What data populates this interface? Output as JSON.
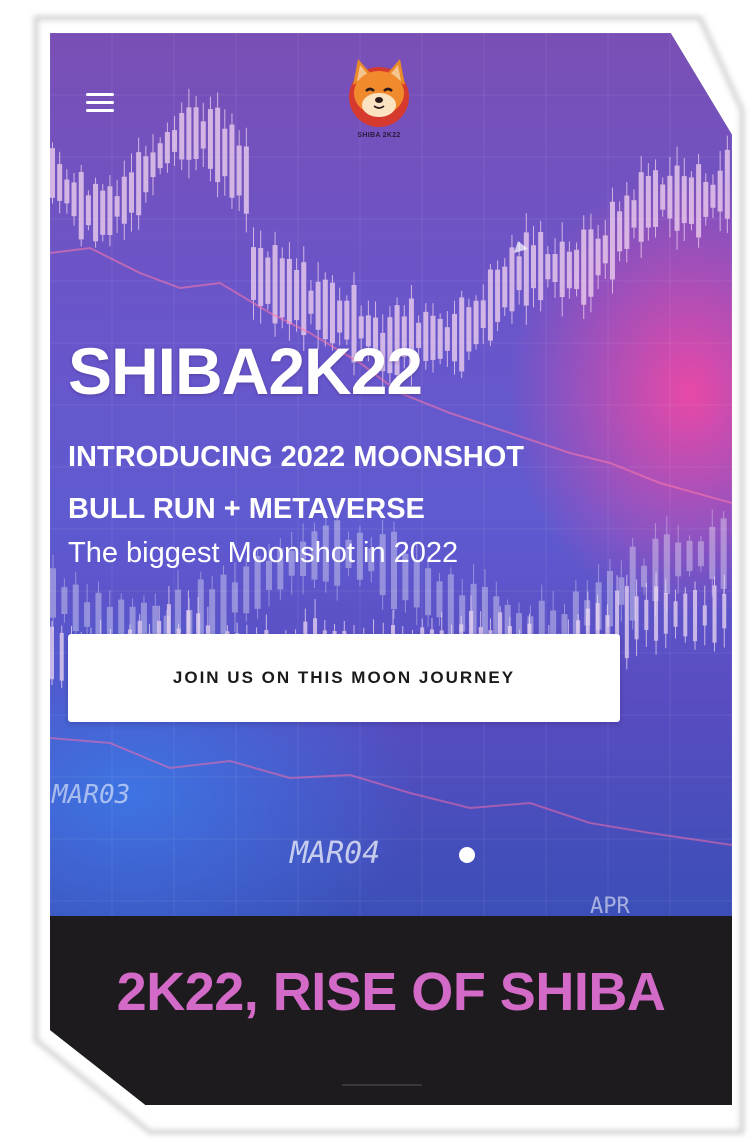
{
  "header": {
    "menu_icon": "hamburger-menu-icon",
    "logo_icon": "shiba-dog-face-icon",
    "logo_text": "SHIBA 2K22"
  },
  "hero": {
    "title": "SHIBA2K22",
    "subtitle_line1": "INTRODUCING 2022 MOONSHOT",
    "subtitle_line2": "BULL RUN + METAVERSE",
    "tagline": "The biggest Moonshot in 2022",
    "cta_label": "JOIN US ON THIS MOON JOURNEY",
    "background_labels": [
      "MAR03",
      "MAR04",
      "APR"
    ],
    "active_slide": 1
  },
  "section": {
    "title": "2K22, RISE OF SHIBA"
  },
  "colors": {
    "accent_pink": "#d46ac8",
    "hero_purple": "#6a55c9",
    "dark_bg": "#1d1b1e",
    "cta_bg": "#ffffff"
  }
}
